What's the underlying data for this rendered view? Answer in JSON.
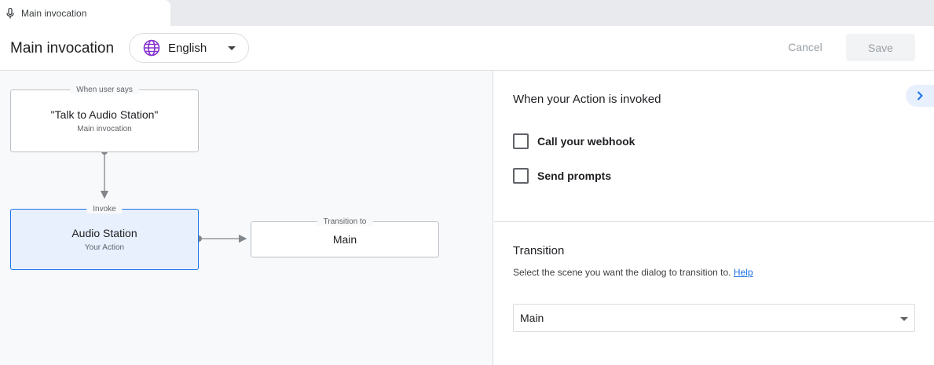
{
  "tab": {
    "title": "Main invocation",
    "icon": "mic-icon"
  },
  "header": {
    "title": "Main invocation",
    "language": {
      "icon": "globe-icon",
      "selected": "English"
    },
    "cancel_label": "Cancel",
    "save_label": "Save"
  },
  "canvas": {
    "trigger": {
      "caption": "When user says",
      "title": "\"Talk to Audio Station\"",
      "subtitle": "Main invocation"
    },
    "invoke": {
      "caption": "Invoke",
      "title": "Audio Station",
      "subtitle": "Your Action"
    },
    "transition": {
      "caption": "Transition to",
      "title": "Main"
    }
  },
  "panel": {
    "invoked_title": "When your Action is invoked",
    "options": [
      {
        "label": "Call your webhook",
        "checked": false
      },
      {
        "label": "Send prompts",
        "checked": false
      }
    ],
    "transition_title": "Transition",
    "transition_help": "Select the scene you want the dialog to transition to.",
    "help_link": "Help",
    "scene_selected": "Main"
  },
  "colors": {
    "accent": "#1a73e8",
    "globe": "#8430ce",
    "active_node_bg": "#e8f0fe"
  }
}
